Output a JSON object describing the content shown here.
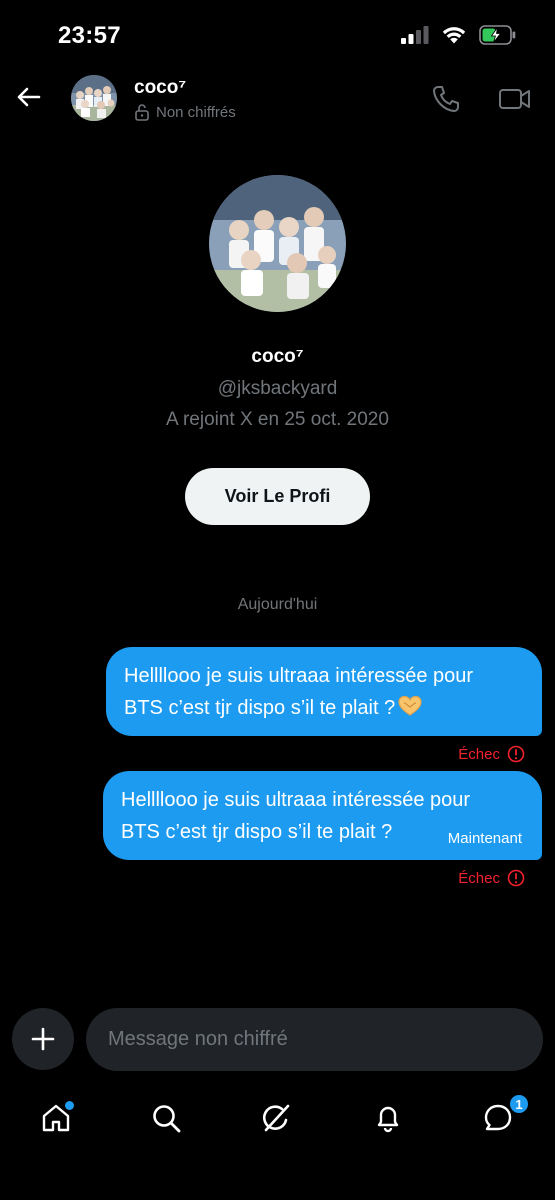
{
  "status_bar": {
    "time": "23:57",
    "icons": [
      "signal-icon",
      "wifi-icon",
      "battery-charging-icon"
    ]
  },
  "header": {
    "back_icon": "arrow-left-icon",
    "name": "coco⁷",
    "encryption_label": "Non chiffrés",
    "lock_icon": "lock-open-icon",
    "call_icon": "phone-icon",
    "video_icon": "video-icon"
  },
  "profile": {
    "name": "coco⁷",
    "handle": "@jksbackyard",
    "joined": "A rejoint X en 25 oct. 2020",
    "view_profile_label": "Voir Le Profi"
  },
  "date_separator": "Aujourd'hui",
  "messages": [
    {
      "line1": "Hellllooo je suis ultraaa intéressée pour",
      "line2": "BTS c’est tjr dispo s’il te plait ?",
      "emoji": "heart-hands-emoji",
      "status": "Échec",
      "status_icon": "info-icon"
    },
    {
      "line1": "Hellllooo je suis ultraaa intéressée pour",
      "line2": "BTS c’est tjr dispo s’il te plait ?",
      "time": "Maintenant",
      "status": "Échec",
      "status_icon": "info-icon"
    }
  ],
  "composer": {
    "add_icon": "plus-icon",
    "placeholder": "Message non chiffré"
  },
  "bottom_nav": {
    "items": [
      "home-icon",
      "search-icon",
      "grok-icon",
      "bell-icon",
      "messages-icon"
    ],
    "messages_badge": "1"
  },
  "colors": {
    "accent": "#1d9bf0",
    "error": "#f4212e",
    "muted": "#71767b",
    "surface": "#202327"
  }
}
